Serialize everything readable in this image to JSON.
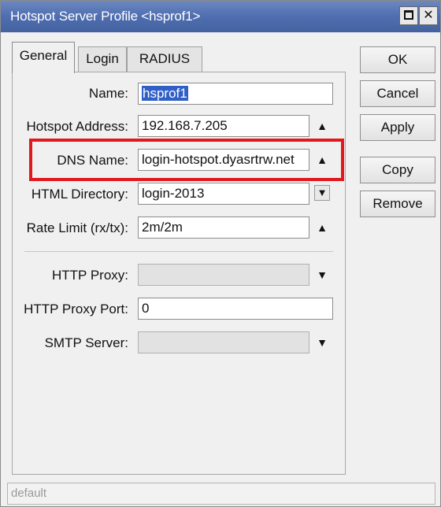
{
  "window": {
    "title": "Hotspot Server Profile <hsprof1>",
    "maximize_icon": "maximize-icon",
    "close_label": "✕"
  },
  "tabs": [
    {
      "label": "General",
      "active": true
    },
    {
      "label": "Login",
      "active": false
    },
    {
      "label": "RADIUS",
      "active": false
    }
  ],
  "form": {
    "name": {
      "label": "Name:",
      "value": "hsprof1"
    },
    "hotspot_address": {
      "label": "Hotspot Address:",
      "value": "192.168.7.205"
    },
    "dns_name": {
      "label": "DNS Name:",
      "value": "login-hotspot.dyasrtrw.net"
    },
    "html_directory": {
      "label": "HTML Directory:",
      "value": "login-2013"
    },
    "rate_limit": {
      "label": "Rate Limit (rx/tx):",
      "value": "2m/2m"
    },
    "http_proxy": {
      "label": "HTTP Proxy:",
      "value": ""
    },
    "http_proxy_port": {
      "label": "HTTP Proxy Port:",
      "value": "0"
    },
    "smtp_server": {
      "label": "SMTP Server:",
      "value": ""
    }
  },
  "glyphs": {
    "up": "▲",
    "down": "▼",
    "dropdown": "▼"
  },
  "buttons": {
    "ok": "OK",
    "cancel": "Cancel",
    "apply": "Apply",
    "copy": "Copy",
    "remove": "Remove"
  },
  "status": {
    "text": "default"
  },
  "colors": {
    "titlebar": "#4f6eb0",
    "highlight_border": "#e0191f",
    "selection": "#2f5fc7"
  }
}
